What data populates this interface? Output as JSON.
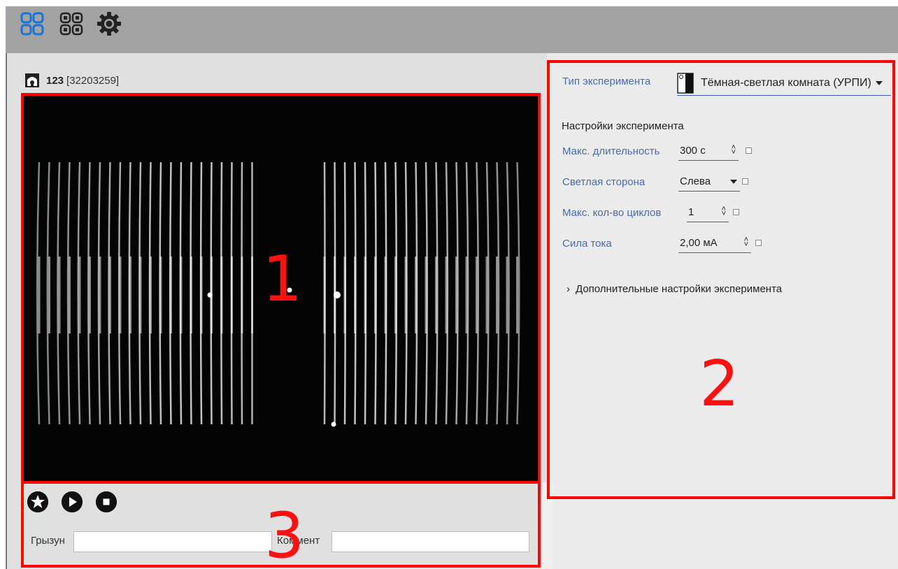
{
  "toolbar": {
    "icons": [
      "grid-2x2-icon",
      "grid-2x2-small-icon",
      "gear-icon"
    ],
    "accent": "#1a73d9"
  },
  "camera": {
    "name": "123",
    "id": "[32203259]",
    "icon": "mouse-cage-icon"
  },
  "video": {
    "annotation": "1"
  },
  "controls": {
    "annotation": "3",
    "buttons": [
      "star-icon",
      "play-icon",
      "stop-icon"
    ],
    "rodent_label": "Грызун",
    "rodent_value": "",
    "comment_label": "Коммент",
    "comment_value": ""
  },
  "settings": {
    "annotation": "2",
    "experiment_type_label": "Тип эксперимента",
    "experiment_type_value": "Тёмная-светлая комната (УРПИ)",
    "section_title": "Настройки эксперимента",
    "rows": [
      {
        "label": "Макс. длительность",
        "value": "300 с"
      },
      {
        "label": "Светлая сторона",
        "value": "Слева"
      },
      {
        "label": "Макс. кол-во циклов",
        "value": "1"
      },
      {
        "label": "Сила тока",
        "value": "2,00 мА"
      }
    ],
    "more_settings": "Дополнительные настройки эксперимента"
  },
  "colors": {
    "annotation_red": "#ff0000",
    "label_blue": "#4a6aa8",
    "toolbar_gray": "#a3a3a3"
  }
}
